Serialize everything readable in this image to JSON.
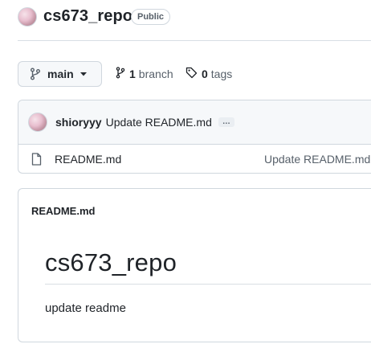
{
  "repo": {
    "name": "cs673_repo",
    "visibility": "Public"
  },
  "branch_bar": {
    "current_branch": "main",
    "branch_count": "1",
    "branch_label": "branch",
    "tag_count": "0",
    "tag_label": "tags"
  },
  "latest_commit": {
    "author": "shioryyy",
    "message": "Update README.md",
    "more": "…"
  },
  "files": [
    {
      "name": "README.md",
      "last_commit": "Update README.md"
    }
  ],
  "readme": {
    "filename": "README.md",
    "heading": "cs673_repo",
    "body": "update readme"
  }
}
